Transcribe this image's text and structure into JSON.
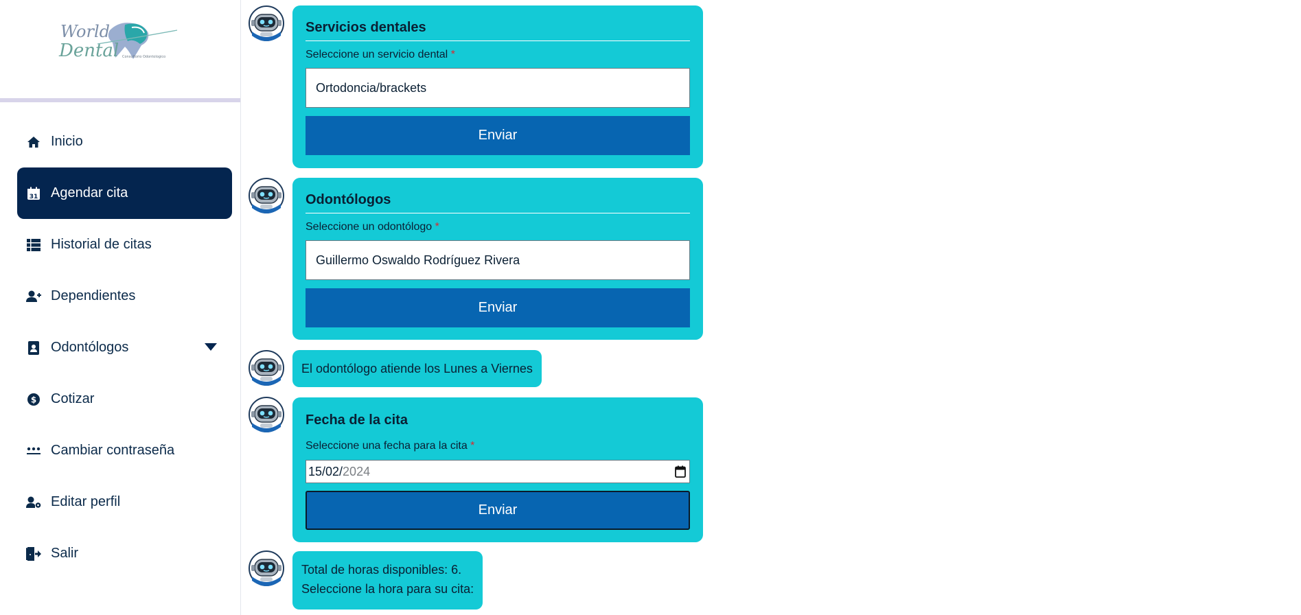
{
  "brand": {
    "logo_line1": "World",
    "logo_line2": "Dental",
    "logo_tagline": "Consultorio Odontologico"
  },
  "sidebar": {
    "items": [
      {
        "label": "Inicio",
        "icon": "home-icon"
      },
      {
        "label": "Agendar cita",
        "icon": "calendar-icon",
        "active": true
      },
      {
        "label": "Historial de citas",
        "icon": "table-list-icon"
      },
      {
        "label": "Dependientes",
        "icon": "user-plus-icon"
      },
      {
        "label": "Odontólogos",
        "icon": "contact-card-icon",
        "has_dropdown": true
      },
      {
        "label": "Cotizar",
        "icon": "dollar-circle-icon"
      },
      {
        "label": "Cambiar contraseña",
        "icon": "password-icon"
      },
      {
        "label": "Editar perfil",
        "icon": "user-gear-icon"
      },
      {
        "label": "Salir",
        "icon": "logout-icon"
      }
    ],
    "calendar_day": "31"
  },
  "chat": {
    "service_card": {
      "title": "Servicios dentales",
      "label": "Seleccione un servicio dental",
      "required_mark": "*",
      "value": "Ortodoncia/brackets",
      "button": "Enviar"
    },
    "dentist_card": {
      "title": "Odontólogos",
      "label": "Seleccione un odontólogo",
      "required_mark": "*",
      "value": "Guillermo Oswaldo Rodríguez Rivera",
      "button": "Enviar"
    },
    "schedule_message": "El odontólogo atiende los Lunes a Viernes",
    "date_card": {
      "title": "Fecha de la cita",
      "label": "Seleccione una fecha para la cita",
      "required_mark": "*",
      "date_day_month": "15/02/",
      "date_year": "2024",
      "button": "Enviar"
    },
    "hours_message": {
      "line1": "Total de horas disponibles: 6.",
      "line2": "Seleccione la hora para su cita:"
    }
  },
  "colors": {
    "sidebar_active": "#04254f",
    "card_bg": "#14cad6",
    "button_bg": "#0765b1",
    "required": "#e0252b"
  }
}
